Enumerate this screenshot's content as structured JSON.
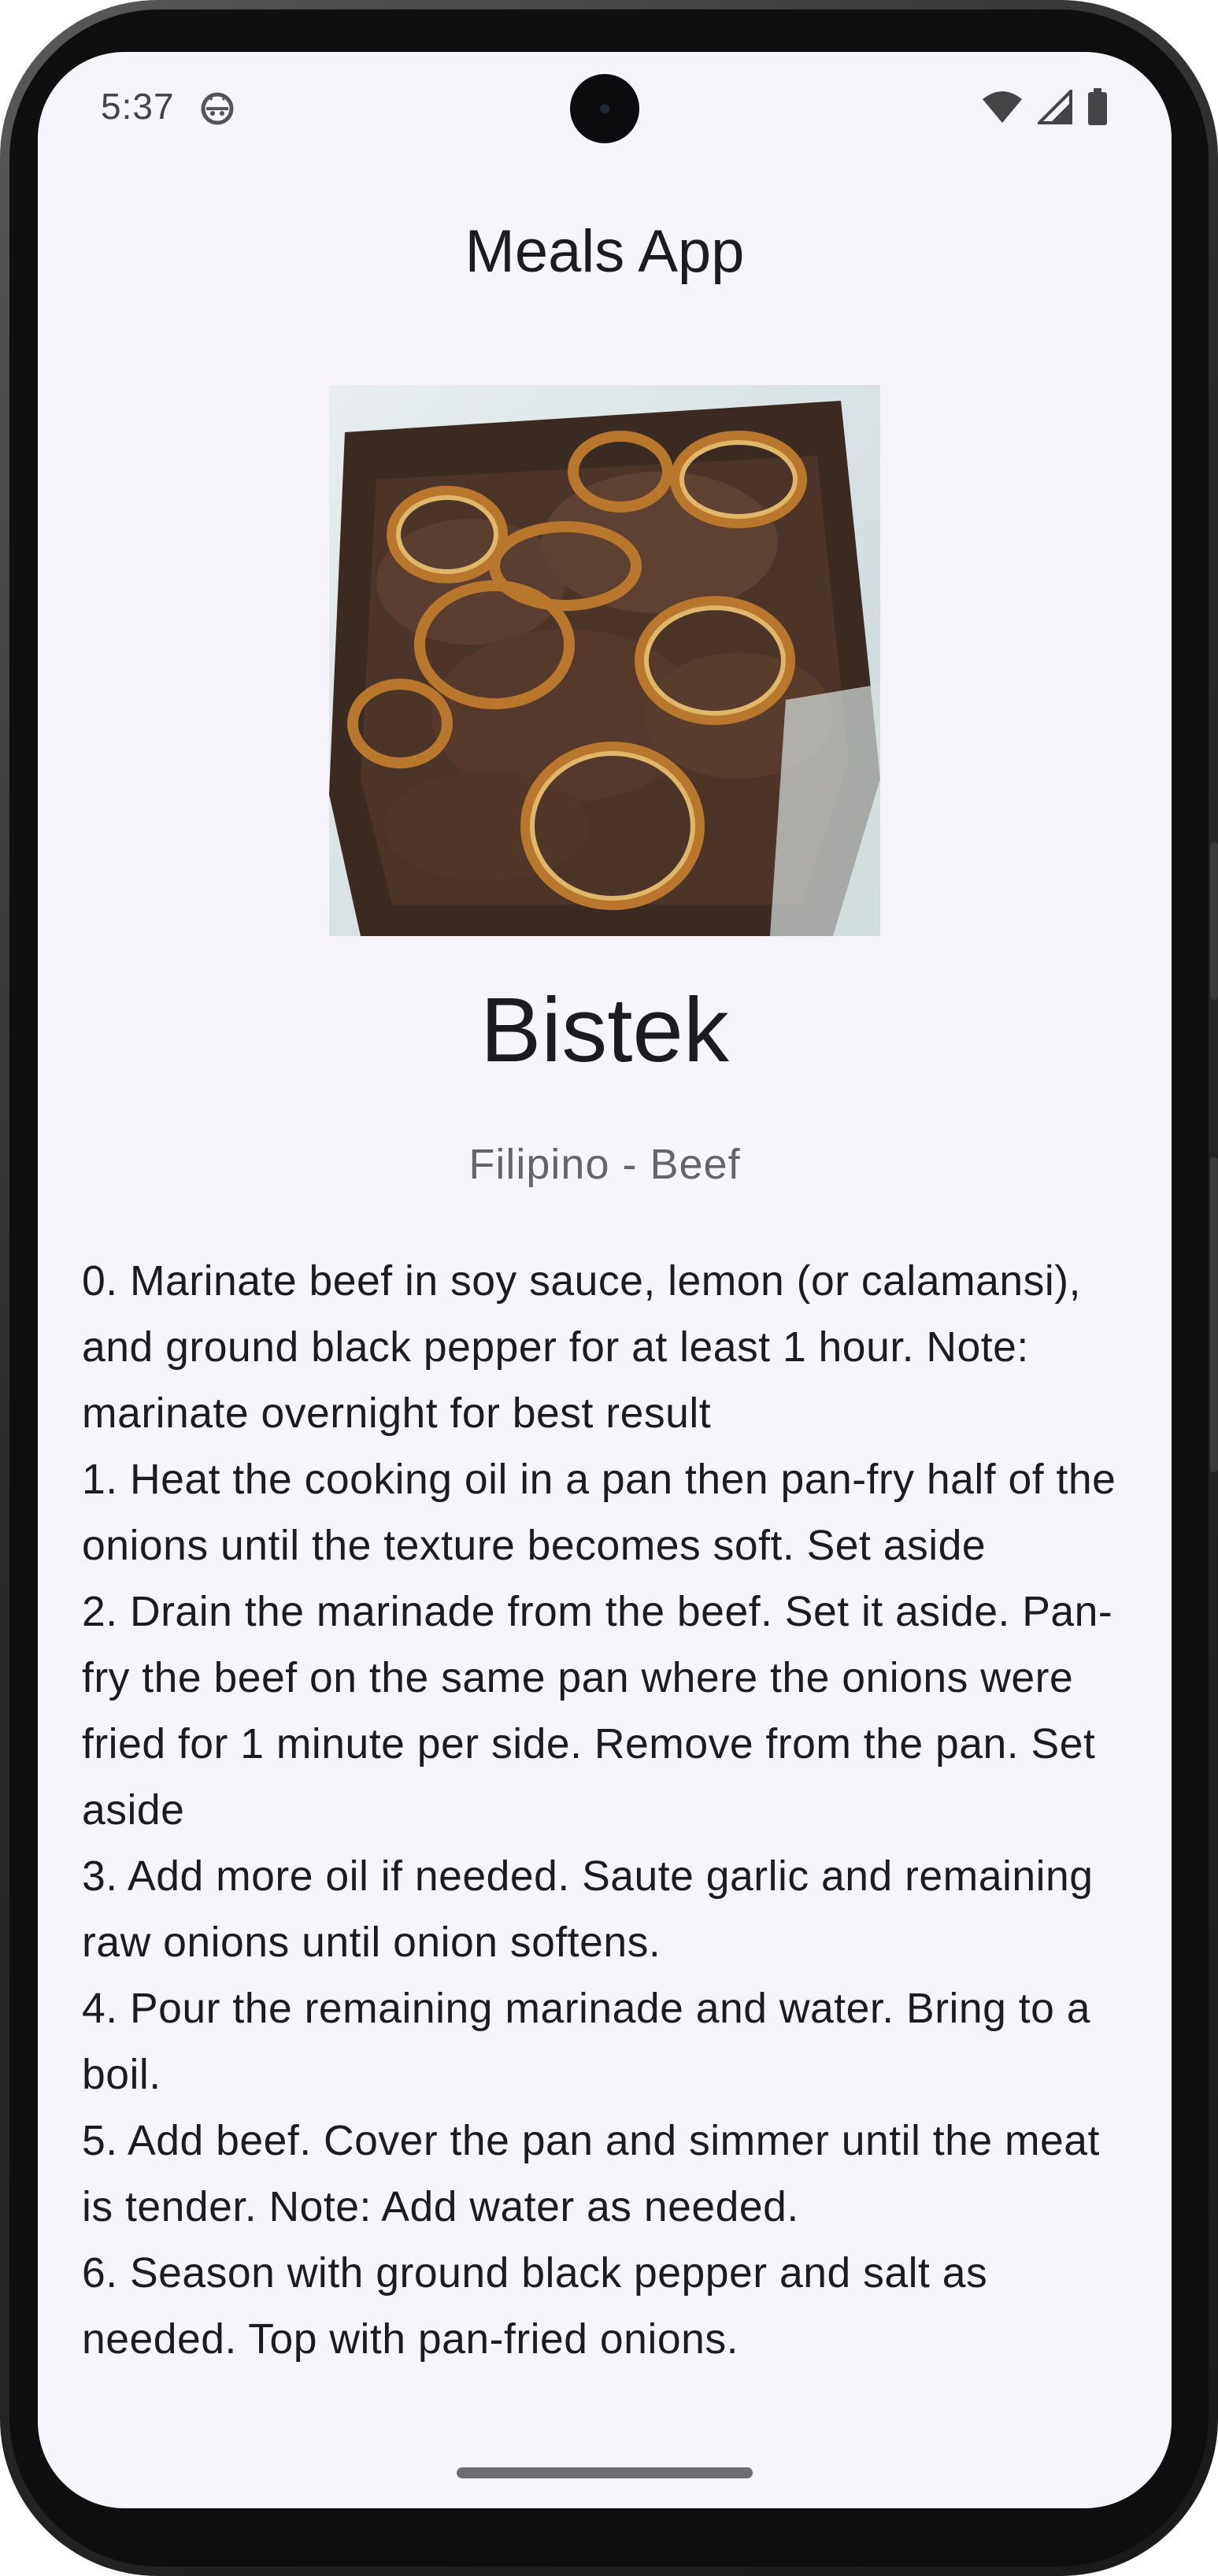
{
  "status_bar": {
    "time": "5:37",
    "app_icon": "android-robot-icon",
    "icons": [
      "wifi-icon",
      "cell-signal-icon",
      "battery-icon"
    ]
  },
  "app_bar": {
    "title": "Meals App"
  },
  "meal": {
    "image_icon": "meal-photo",
    "name": "Bistek",
    "meta": "Filipino - Beef",
    "instructions": [
      "0. Marinate beef in soy sauce, lemon (or calamansi), and ground black pepper for at least 1 hour. Note: marinate overnight for best result",
      "1. Heat the cooking oil in a pan then pan-fry half of the onions until the texture becomes soft. Set aside",
      "2. Drain the marinade from the beef. Set it aside. Pan-fry the beef on the same pan where the onions were fried for 1 minute per side. Remove from the pan. Set aside",
      "3. Add more oil if needed. Saute garlic and remaining raw onions until onion softens.",
      "4. Pour the remaining marinade and water. Bring to a boil.",
      "5. Add beef. Cover the pan and simmer until the meat is tender. Note: Add water as needed.",
      "6. Season with ground black pepper and salt as needed. Top with pan-fried onions."
    ]
  },
  "colors": {
    "background": "#f7f5fb",
    "text_primary": "#1c1b1f",
    "text_secondary": "#666469"
  }
}
